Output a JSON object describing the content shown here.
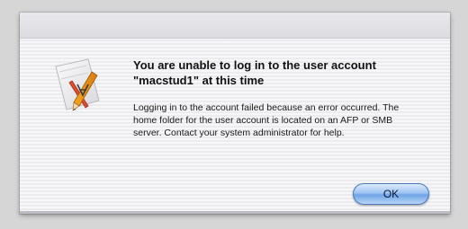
{
  "dialog": {
    "icon": "app-icon-pencil-ruler",
    "title": "You are unable to log in to the user account \"macstud1\" at this time",
    "message": "Logging in to the account failed because an error occurred. The home folder for the user account is located on an AFP or SMB server. Contact your system administrator for help.",
    "ok_label": "OK"
  },
  "colors": {
    "button_accent": "#6ea3e6",
    "background": "#d6d6d6"
  }
}
